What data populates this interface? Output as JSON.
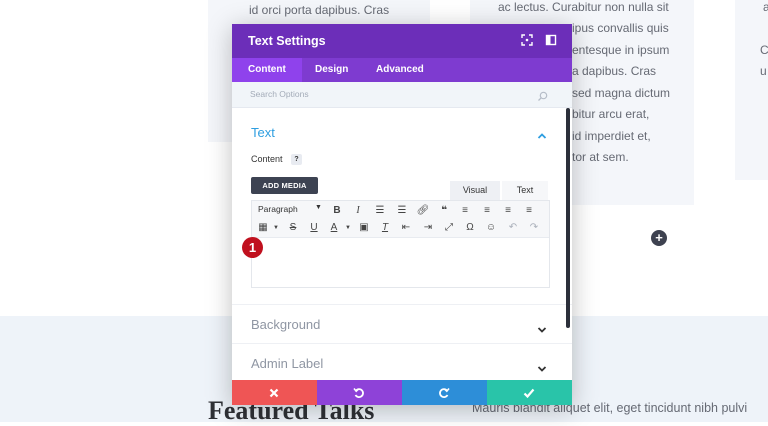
{
  "background": {
    "col1_text": [
      "id orci porta dapibus. Cras"
    ],
    "col2_text": [
      "ac lectus. Curabitur non nulla sit",
      "ipus convallis quis",
      "entesque in ipsum",
      "a dapibus. Cras",
      "sed magna dictum",
      "bitur arcu erat,",
      "id imperdiet et,",
      "tor at sem."
    ],
    "col3_text": [
      "a",
      "C",
      "u"
    ],
    "featured_title": "Featured Talks",
    "mauris_text": "Mauris blandit aliquet elit, eget tincidunt nibh pulvi",
    "add_row_label": "+"
  },
  "modal": {
    "title": "Text Settings",
    "colors": {
      "header": "#6c2eb9",
      "tabs": "#7e3bd0",
      "accent": "#2e9ee0"
    },
    "tabs": [
      {
        "label": "Content",
        "active": true
      },
      {
        "label": "Design",
        "active": false
      },
      {
        "label": "Advanced",
        "active": false
      }
    ],
    "search": {
      "placeholder": "Search Options"
    },
    "text_section": {
      "title": "Text",
      "content_label": "Content",
      "help_label": "?",
      "add_media_label": "ADD MEDIA",
      "editor_tabs": [
        "Visual",
        "Text"
      ],
      "toolbar": {
        "paragraph_label": "Paragraph",
        "row1_icons": [
          "bold-icon",
          "italic-icon",
          "bullet-list-icon",
          "numbered-list-icon",
          "link-icon",
          "blockquote-icon",
          "align-left-icon",
          "align-center-icon",
          "align-right-icon",
          "align-justify-icon"
        ],
        "row2_icons": [
          "table-icon",
          "strikethrough-icon",
          "underline-icon",
          "text-color-icon",
          "paste-text-icon",
          "clear-format-icon",
          "outdent-icon",
          "indent-icon",
          "fullscreen-icon",
          "special-char-icon",
          "emoji-icon",
          "undo-icon",
          "redo-icon"
        ]
      }
    },
    "collapsed_sections": [
      {
        "title": "Background"
      },
      {
        "title": "Admin Label"
      }
    ],
    "actions": [
      {
        "name": "discard",
        "icon": "close-icon",
        "color": "#ef5555"
      },
      {
        "name": "undo",
        "icon": "undo-icon",
        "color": "#8e42d8"
      },
      {
        "name": "redo",
        "icon": "redo-icon",
        "color": "#2d8ed8"
      },
      {
        "name": "save",
        "icon": "check-icon",
        "color": "#29c4a9"
      }
    ]
  },
  "annotation_badge": "1"
}
